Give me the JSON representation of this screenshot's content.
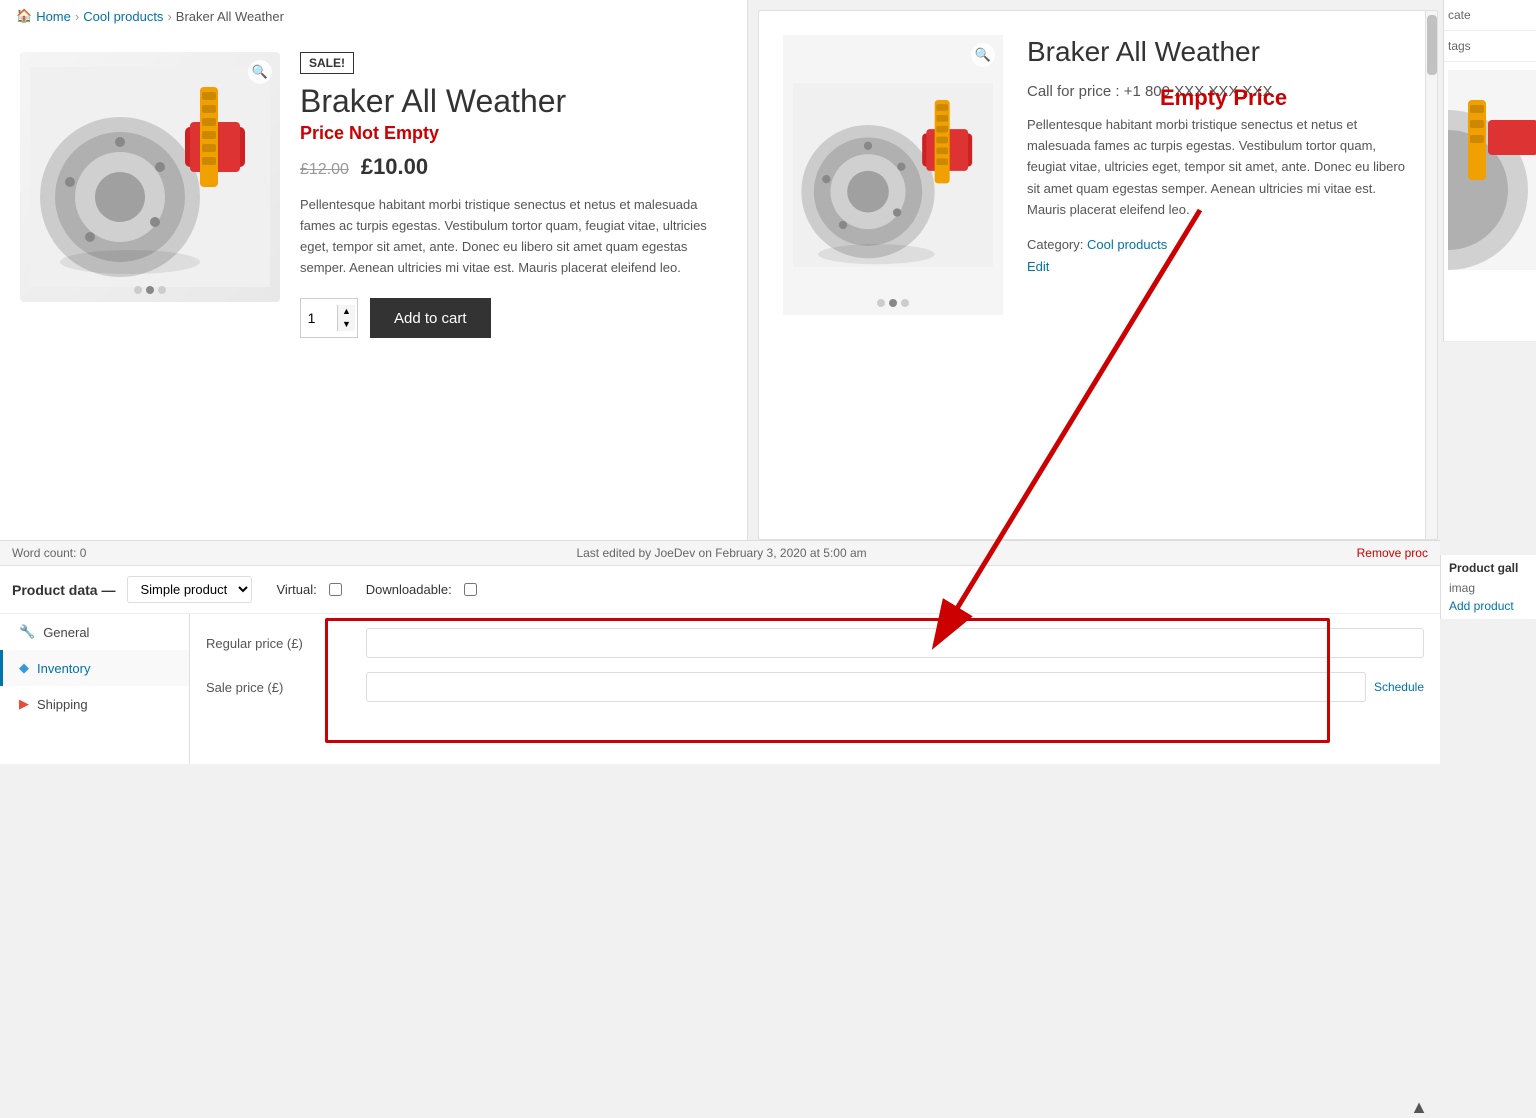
{
  "breadcrumb": {
    "home": "Home",
    "sep1": "›",
    "cool_products": "Cool products",
    "sep2": "›",
    "current": "Braker All Weather"
  },
  "product_left": {
    "sale_badge": "SALE!",
    "title": "Braker All Weather",
    "price_annotation": "Price Not Empty",
    "original_price": "£12.00",
    "sale_price": "£10.00",
    "description": "Pellentesque habitant morbi tristique senectus et netus et malesuada fames ac turpis egestas. Vestibulum tortor quam, feugiat vitae, ultricies eget, tempor sit amet, ante. Donec eu libero sit amet quam egestas semper. Aenean ultricies mi vitae est. Mauris placerat eleifend leo.",
    "qty_value": "1",
    "add_to_cart": "Add to cart"
  },
  "product_right": {
    "title": "Braker All Weather",
    "call_for_price": "Call for price : +1 800 XXX XXX XXX",
    "empty_price_annotation": "Empty Price",
    "description": "Pellentesque habitant morbi tristique senectus et netus et malesuada fames ac turpis egestas. Vestibulum tortor quam, feugiat vitae, ultricies eget, tempor sit amet, ante. Donec eu libero sit amet quam egestas semper. Aenean ultricies mi vitae est. Mauris placerat eleifend leo.",
    "category_label": "Category:",
    "category_link": "Cool products",
    "edit_link": "Edit"
  },
  "admin_bar": {
    "word_count": "Word count: 0",
    "last_edited": "Last edited by JoeDev on February 3, 2020 at 5:00 am"
  },
  "product_data": {
    "label": "Product data —",
    "type_select": "Simple product",
    "virtual_label": "Virtual:",
    "downloadable_label": "Downloadable:"
  },
  "tabs": [
    {
      "id": "general",
      "icon": "⚙",
      "label": "General",
      "active": false
    },
    {
      "id": "inventory",
      "icon": "◆",
      "label": "Inventory",
      "active": true
    },
    {
      "id": "shipping",
      "icon": "▶",
      "label": "Shipping",
      "active": false
    }
  ],
  "fields": {
    "regular_price_label": "Regular price (£)",
    "regular_price_value": "",
    "sale_price_label": "Sale price (£)",
    "sale_price_value": "",
    "schedule_link": "Schedule"
  },
  "sidebar": {
    "product_gallery_label": "Product gall",
    "add_product_link": "Add product",
    "remove_link": "Remove proc",
    "cate_label": "cate",
    "tags_label": "tags",
    "imag_label": "imag"
  },
  "colors": {
    "red_annotation": "#cc0000",
    "link_blue": "#0073aa",
    "accent_blue": "#0073aa"
  }
}
